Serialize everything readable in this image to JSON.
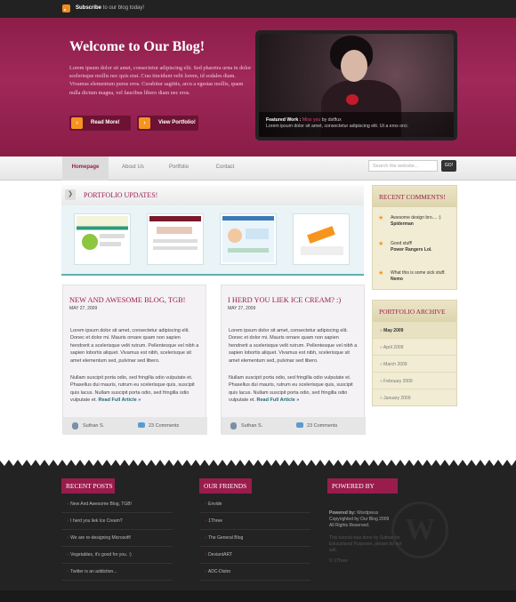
{
  "topbar": {
    "subscribe_strong": "Subscribe",
    "subscribe_rest": " to our blog today!"
  },
  "hero": {
    "title": "Welcome to Our Blog!",
    "text": "Lorem ipsum dolor sit amet, consectetur adipiscing elit. Sed pharetra urna in dolor scelerisque mollis nec quis erat. Cras tincidunt velit lorem, id sodales diam. Vivamus elementum purus eros. Curabitur sagittis, arcu a egestas mollis, quam nulla dictum magna, vel faucibus libero diam nec eros.",
    "btn_read": "Read More!",
    "btn_portfolio": "View Portfolio!",
    "featured_label": "Featured Work : ",
    "featured_name": "Miss you",
    "featured_by": " by dstflux",
    "featured_text": "Lorem ipsum dolor sit amet, consectetur adipiscing elit. Ut a eros orci."
  },
  "nav": {
    "items": [
      "Homepage",
      "About Us",
      "Portfolio",
      "Contact"
    ],
    "search_placeholder": "Search the website...",
    "go": "GO!"
  },
  "portfolio": {
    "title": "PORTFOLIO UPDATES!",
    "arrow": "❯"
  },
  "posts": [
    {
      "title": "NEW AND AWESOME BLOG, TGB!",
      "date": "MAY 27, 2009",
      "body1": "Lorem ipsum dolor sit amet, consectetur adipiscing elit. Donec et dolor mi. Mauris ornare quam non sapien hendrerit a scelerisque velit rutrum. Pellentesque vel nibh a sapien lobortis aliquet. Vivamus est nibh, scelerisque sit amet elementum sed, pulvinar sed libero.",
      "body2": "Nullam suscipit porta odio, sed fringilla odio vulputate et. Phasellus dui mauris, rutrum eu scelerisque quis, suscipit quis lacus. Nullam suscipit porta odio, sed fringilla odio vulputate et.",
      "readmore": "Read Full Article  »",
      "author": "Suthan S.",
      "comments": "23 Comments"
    },
    {
      "title": "I HERD YOU LIEK ICE CREAM? :)",
      "date": "MAY 27, 2009",
      "body1": "Lorem ipsum dolor sit amet, consectetur adipiscing elit. Donec et dolor mi. Mauris ornare quam non sapien hendrerit a scelerisque velit rutrum. Pellentesque vel nibh a sapien lobortis aliquet. Vivamus est nibh, scelerisque sit amet elementum sed, pulvinar sed libero.",
      "body2": "Nullam suscipit porta odio, sed fringilla odio vulputate et. Phasellus dui mauris, rutrum eu scelerisque quis, suscipit quis lacus. Nullam suscipit porta odio, sed fringilla odio vulputate et.",
      "readmore": "Read Full Article  »",
      "author": "Suthan S.",
      "comments": "23 Comments"
    }
  ],
  "sidebar": {
    "comments_title": "RECENT COMMENTS!",
    "comments": [
      {
        "text": "Awesome design bro.... :)",
        "who": "Spiderman"
      },
      {
        "text": "Good stuff!",
        "who": "Power Rangers Lol."
      },
      {
        "text": "What this is some sick stuff.",
        "who": "Nemo"
      }
    ],
    "archive_title": "PORTFOLIO ARCHIVE",
    "archive": [
      "May 2009",
      "April 2009",
      "March 2009",
      "February 2009",
      "January 2009"
    ]
  },
  "footer": {
    "recent_title": "RECENT POSTS",
    "recent": [
      "New And Awesome Blog, TGB!",
      "I herd you liek Ice Cream?",
      "We are re-designing Microsoft!",
      "Vegetables, it's good for you. :)",
      "Twitter is an addiction..."
    ],
    "friends_title": "OUR FRIENDS",
    "friends": [
      "Envide",
      "1Three",
      "The General Blog",
      "DeviantART",
      "ADC-Distro"
    ],
    "powered_title": "POWERED BY",
    "powered_label": "Powered by: ",
    "powered_value": "Wordpress",
    "copyright": "Copyrighted by Our Blog 2009",
    "rights": "All Rights Reserved.",
    "tutorial": "This tutorial was done by Suthan for Educational Purposes, please do not sell.",
    "credit": "© 1Three",
    "wp_glyph": "W"
  },
  "colors": {
    "brand": "#9a1c4c",
    "accent": "#f7941e",
    "teal": "#5fb1b3"
  }
}
